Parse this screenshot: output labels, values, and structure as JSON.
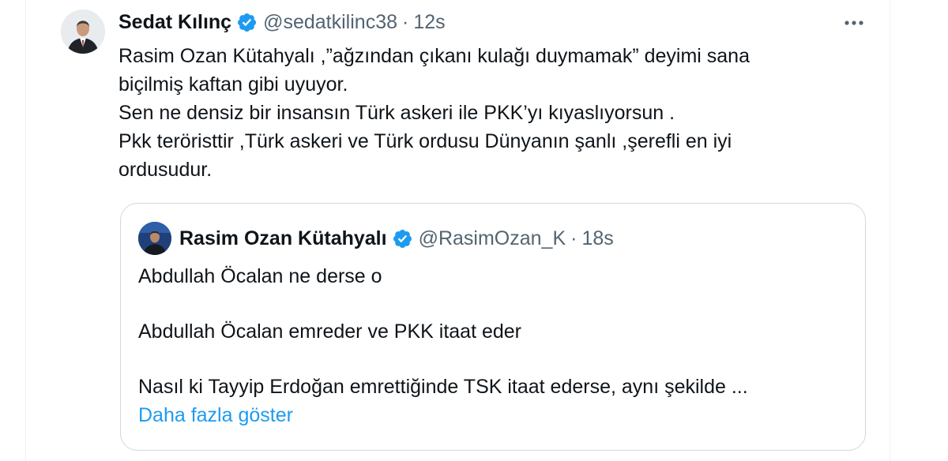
{
  "tweet": {
    "author_name": "Sedat Kılınç",
    "handle": "@sedatkilinc38",
    "separator": "·",
    "time": "12s",
    "more_label": "•••",
    "lines": [
      "Rasim Ozan Kütahyalı ,”ağzından çıkanı kulağı duymamak” deyimi sana",
      "biçilmiş kaftan gibi uyuyor.",
      "Sen ne densiz bir insansın Türk askeri ile PKK’yı kıyaslıyorsun .",
      "Pkk teröristtir ,Türk askeri ve Türk ordusu Dünyanın şanlı ,şerefli en iyi",
      "ordusudur."
    ]
  },
  "quote": {
    "author_name": "Rasim Ozan Kütahyalı",
    "handle": "@RasimOzan_K",
    "separator": "·",
    "time": "18s",
    "paragraphs": [
      "Abdullah Öcalan ne derse o",
      "Abdullah Öcalan emreder ve PKK itaat eder",
      "Nasıl ki Tayyip Erdoğan emrettiğinde TSK itaat ederse, aynı şekilde ..."
    ],
    "show_more": "Daha fazla göster"
  },
  "colors": {
    "text": "#0f1419",
    "secondary": "#536471",
    "accent": "#1d9bf0",
    "border": "#cfd9de"
  },
  "icons": {
    "verified": "verified-badge-icon",
    "more": "more-horizontal-icon"
  }
}
